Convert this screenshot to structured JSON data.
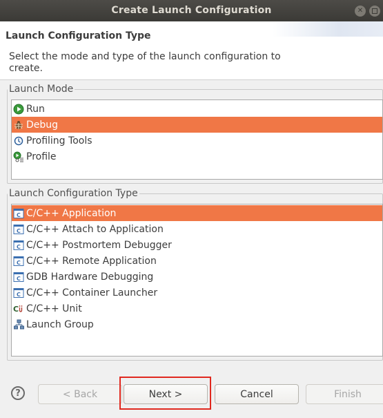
{
  "window": {
    "title": "Create Launch Configuration"
  },
  "header": {
    "title": "Launch Configuration Type",
    "description": "Select the mode and type of the launch configuration to create."
  },
  "launch_mode": {
    "legend": "Launch Mode",
    "selected": "Debug",
    "items": [
      {
        "label": "Run",
        "icon": "run-icon"
      },
      {
        "label": "Debug",
        "icon": "debug-bug-icon"
      },
      {
        "label": "Profiling Tools",
        "icon": "profiling-tools-icon"
      },
      {
        "label": "Profile",
        "icon": "profile-icon"
      }
    ]
  },
  "config_type": {
    "legend": "Launch Configuration Type",
    "selected": "C/C++ Application",
    "items": [
      {
        "label": "C/C++ Application",
        "icon": "c-application-icon"
      },
      {
        "label": "C/C++ Attach to Application",
        "icon": "c-application-icon"
      },
      {
        "label": "C/C++ Postmortem Debugger",
        "icon": "c-application-icon"
      },
      {
        "label": "C/C++ Remote Application",
        "icon": "c-application-icon"
      },
      {
        "label": "GDB Hardware Debugging",
        "icon": "c-application-icon"
      },
      {
        "label": "C/C++ Container Launcher",
        "icon": "c-application-icon"
      },
      {
        "label": "C/C++ Unit",
        "icon": "c-unit-icon"
      },
      {
        "label": "Launch Group",
        "icon": "launch-group-icon"
      }
    ]
  },
  "buttons": {
    "help": "?",
    "back": "< Back",
    "next": "Next >",
    "cancel": "Cancel",
    "finish": "Finish"
  },
  "colors": {
    "selection": "#f07746",
    "highlight_box": "#e0281e"
  }
}
